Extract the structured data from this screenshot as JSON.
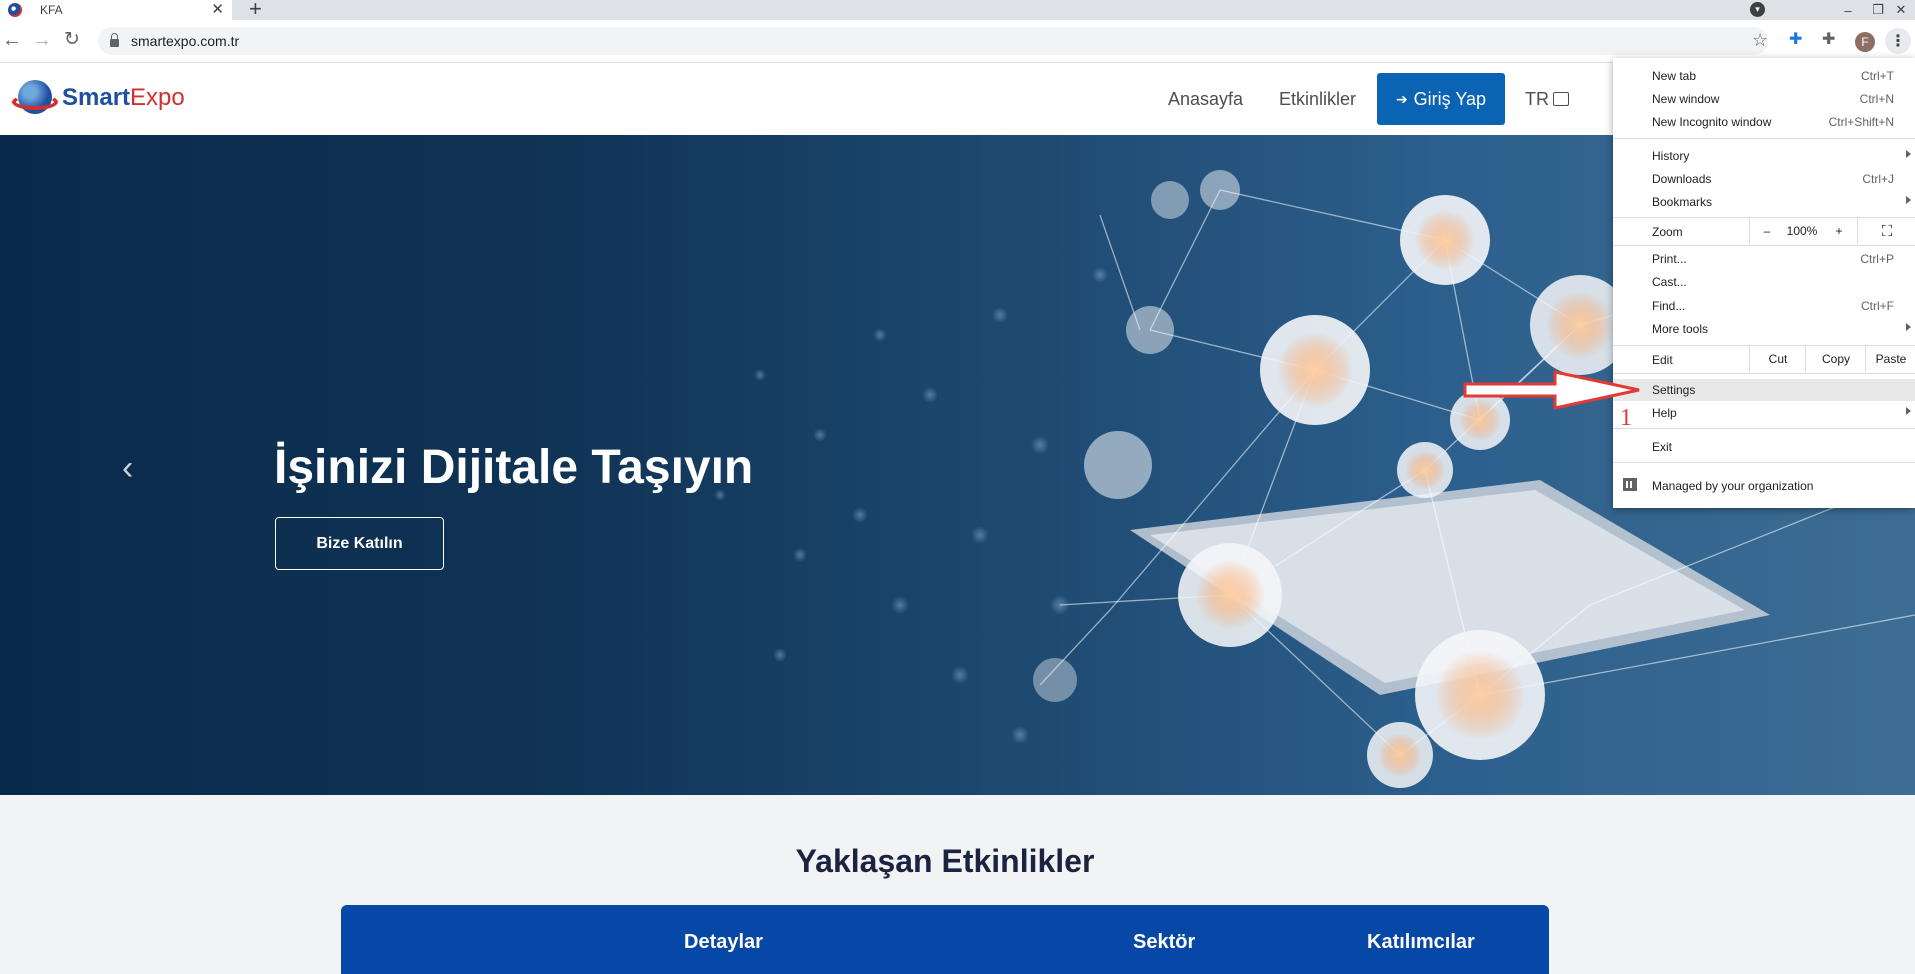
{
  "browser": {
    "tab_title": "KFA",
    "tab_close": "✕",
    "new_tab_glyph": "+",
    "url": "smartexpo.com.tr",
    "profile_initial": "F",
    "window_controls": [
      "–",
      "❐",
      "✕"
    ]
  },
  "site": {
    "logo_smart": "Smart",
    "logo_expo": "Expo",
    "nav": [
      "Anasayfa",
      "Etkinlikler"
    ],
    "login_label": "Giriş Yap",
    "lang_label": "TR"
  },
  "hero": {
    "title": "İşinizi Dijitale Taşıyın",
    "cta": "Bize Katılın",
    "prev_glyph": "‹"
  },
  "events": {
    "title": "Yaklaşan Etkinlikler",
    "columns": [
      "Detaylar",
      "Sektör",
      "Katılımcılar"
    ]
  },
  "menu": {
    "new_tab": {
      "label": "New tab",
      "shortcut": "Ctrl+T"
    },
    "new_window": {
      "label": "New window",
      "shortcut": "Ctrl+N"
    },
    "incognito": {
      "label": "New Incognito window",
      "shortcut": "Ctrl+Shift+N"
    },
    "history": {
      "label": "History"
    },
    "downloads": {
      "label": "Downloads",
      "shortcut": "Ctrl+J"
    },
    "bookmarks": {
      "label": "Bookmarks"
    },
    "zoom": {
      "label": "Zoom",
      "minus": "–",
      "value": "100%",
      "plus": "+"
    },
    "print": {
      "label": "Print...",
      "shortcut": "Ctrl+P"
    },
    "cast": {
      "label": "Cast..."
    },
    "find": {
      "label": "Find...",
      "shortcut": "Ctrl+F"
    },
    "more_tools": {
      "label": "More tools"
    },
    "edit": {
      "label": "Edit",
      "cut": "Cut",
      "copy": "Copy",
      "paste": "Paste"
    },
    "settings": {
      "label": "Settings"
    },
    "help": {
      "label": "Help"
    },
    "exit": {
      "label": "Exit"
    },
    "managed": {
      "label": "Managed by your organization"
    }
  },
  "annotation": {
    "number": "1",
    "color": "#e53935"
  },
  "colors": {
    "menu_highlight": "#e8e8e8",
    "login_button": "#0a63b3",
    "table_header": "#0747a6"
  }
}
